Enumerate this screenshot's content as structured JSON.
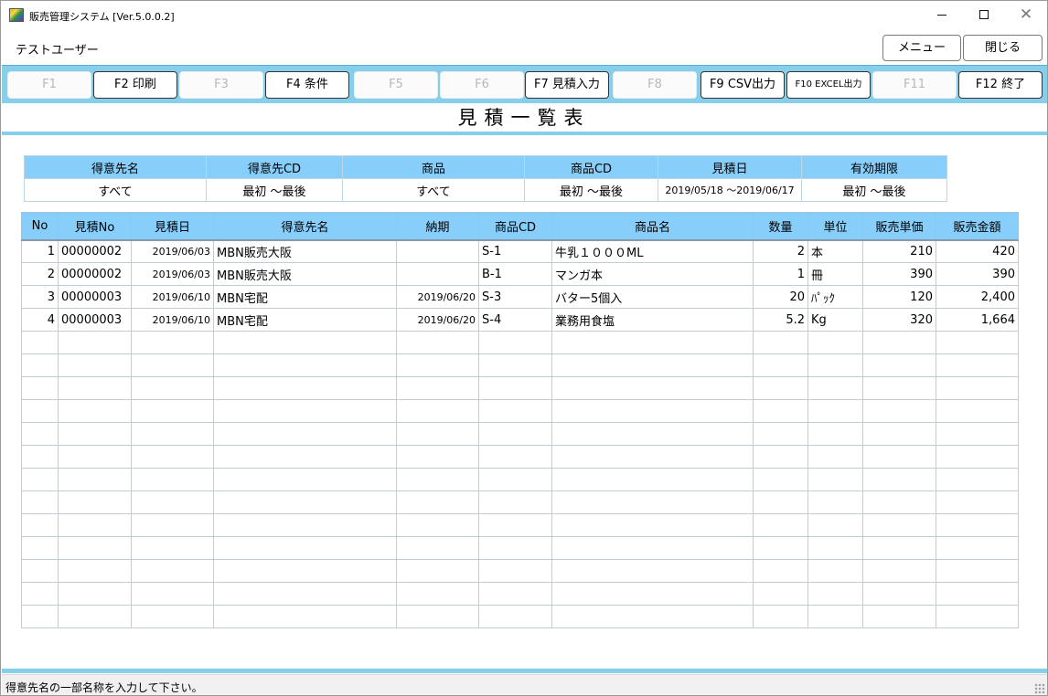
{
  "window": {
    "title": "販売管理システム [Ver.5.0.0.2]",
    "minimize_label": "",
    "close_label": "✕"
  },
  "header": {
    "user": "テストユーザー",
    "menu_label": "メニュー",
    "close_label": "閉じる"
  },
  "fkeys": [
    {
      "label": "F1",
      "enabled": false
    },
    {
      "label": "F2 印刷",
      "enabled": true
    },
    {
      "label": "F3",
      "enabled": false
    },
    {
      "label": "F4 条件",
      "enabled": true
    },
    {
      "label": "F5",
      "enabled": false
    },
    {
      "label": "F6",
      "enabled": false
    },
    {
      "label": "F7 見積入力",
      "enabled": true
    },
    {
      "label": "F8",
      "enabled": false
    },
    {
      "label": "F9 CSV出力",
      "enabled": true
    },
    {
      "label": "F10 EXCEL出力",
      "enabled": true
    },
    {
      "label": "F11",
      "enabled": false
    },
    {
      "label": "F12 終了",
      "enabled": true
    }
  ],
  "page_title": "見積一覧表",
  "conditions": {
    "headers": [
      "得意先名",
      "得意先CD",
      "商品",
      "商品CD",
      "見積日",
      "有効期限"
    ],
    "values": [
      "すべて",
      "最初 ～最後",
      "すべて",
      "最初 ～最後",
      "2019/05/18 ～2019/06/17",
      "最初 ～最後"
    ]
  },
  "grid": {
    "columns": [
      "No",
      "見積No",
      "見積日",
      "得意先名",
      "納期",
      "商品CD",
      "商品名",
      "数量",
      "単位",
      "販売単価",
      "販売金額"
    ],
    "rows": [
      [
        "1",
        "00000002",
        "2019/06/03",
        "MBN販売大阪",
        "",
        "S-1",
        "牛乳１０００ML",
        "2",
        "本",
        "210",
        "420"
      ],
      [
        "2",
        "00000002",
        "2019/06/03",
        "MBN販売大阪",
        "",
        "B-1",
        "マンガ本",
        "1",
        "冊",
        "390",
        "390"
      ],
      [
        "3",
        "00000003",
        "2019/06/10",
        "MBN宅配",
        "2019/06/20",
        "S-3",
        "バター5個入",
        "20",
        "ﾊﾟｯｸ",
        "120",
        "2,400"
      ],
      [
        "4",
        "00000003",
        "2019/06/10",
        "MBN宅配",
        "2019/06/20",
        "S-4",
        "業務用食塩",
        "5.2",
        "Kg",
        "320",
        "1,664"
      ]
    ]
  },
  "status": {
    "message": "得意先名の一部名称を入力して下さい。"
  },
  "colors": {
    "accent": "#87ceeb",
    "header_fill": "#87cefa"
  }
}
